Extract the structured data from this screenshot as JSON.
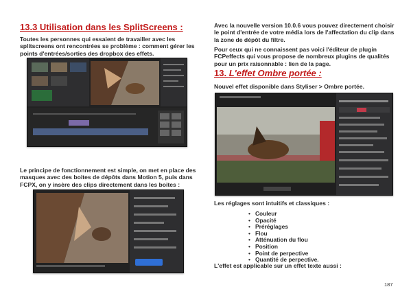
{
  "left": {
    "heading": "13.3 Utilisation dans les SplitScreens :",
    "intro": "Toutes les personnes qui essaient de travailler avec les splitscreens ont rencontrées se problème : comment gérer les points d'entrées/sorties des dropbox des effets.",
    "paragraph2": "Le principe de fonctionnement est simple, on met en place des masques avec des boites de dépôts dans Motion 5, puis dans FCPX, on y insère des clips directement dans les boites :"
  },
  "right": {
    "intro": "Avec la nouvelle version 10.0.6 vous pouvez directement choisir le point d'entrée de votre média lors de l'affectation du clip dans la zone de dépôt du filtre.",
    "plugin_text": "Pour ceux qui ne connaissent pas voici l'éditeur de plugin FCPeffects qui vous propose de nombreux plugins de qualités pour un prix raisonnable : lien de la page.",
    "heading_prefix": "13. ",
    "heading_italic": "L'effet Ombre portée :",
    "new_effect": "Nouvel effet disponible dans Styliser > Ombre portée.",
    "settings_intro": "Les réglages sont intuitifs et classiques :",
    "settings": [
      "Couleur",
      "Opacité",
      "Préréglages",
      "Flou",
      "Atténuation du flou",
      "Position",
      "Point de perpective",
      "Quantité de perpective."
    ],
    "closing": "L'effet est applicable sur un effet texte aussi :"
  },
  "page_number": "187",
  "colors": {
    "heading_red": "#c21a1a",
    "ui_dark": "#222222",
    "accent_blue": "#2f6fd6"
  }
}
